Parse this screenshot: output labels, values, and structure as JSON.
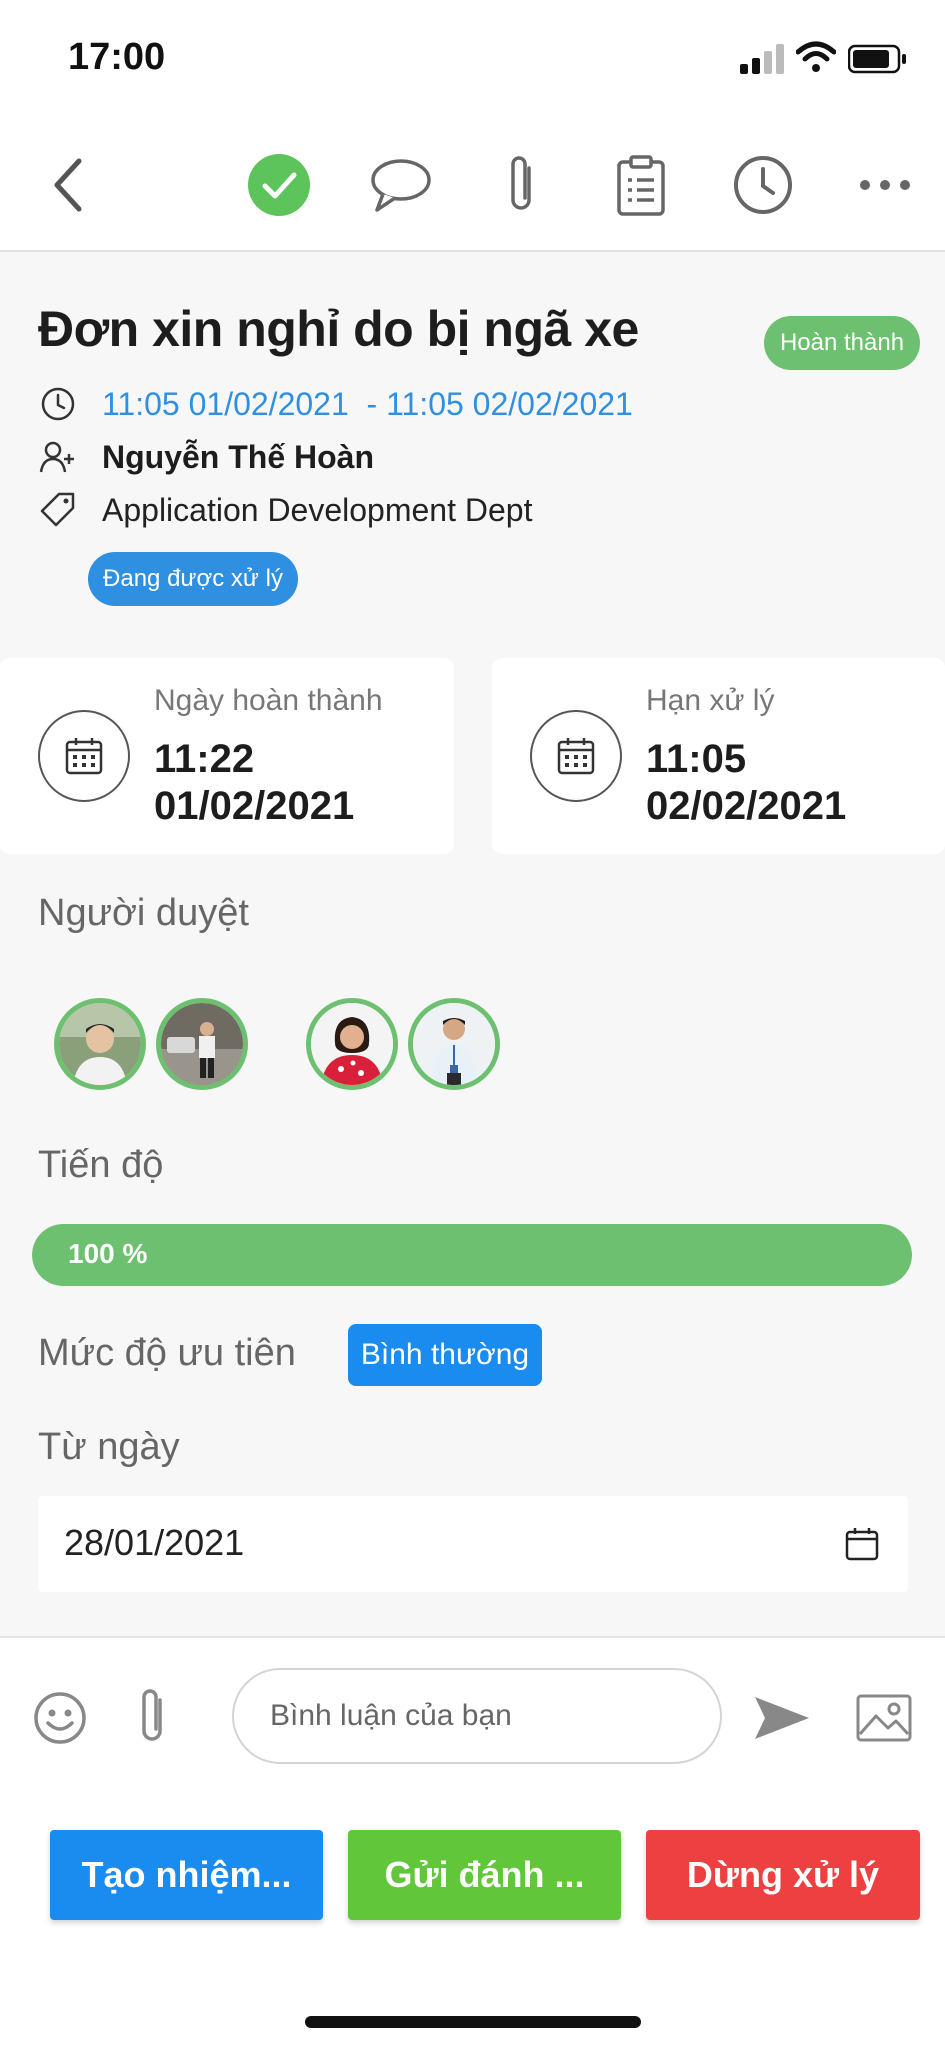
{
  "status_bar": {
    "time": "17:00"
  },
  "toolbar": {
    "icons": [
      "back-icon",
      "check-circle-icon",
      "chat-icon",
      "paperclip-icon",
      "clipboard-icon",
      "clock-icon",
      "more-icon"
    ],
    "accent": "#6cc070"
  },
  "task": {
    "title": "Đơn xin nghỉ do bị ngã xe",
    "status_badge": "Hoàn thành",
    "date_range": "11:05 01/02/2021  - 11:05 02/02/2021",
    "creator": "Nguyễn Thế Hoàn",
    "department": "Application Development Dept",
    "processing_badge": "Đang được xử lý"
  },
  "cards": [
    {
      "label": "Ngày hoàn thành",
      "time": "11:22",
      "date": "01/02/2021"
    },
    {
      "label": "Hạn xử lý",
      "time": "11:05",
      "date": "02/02/2021"
    }
  ],
  "approvers": {
    "label": "Người duyệt"
  },
  "progress": {
    "label": "Tiến độ",
    "value": 100,
    "text": "100 %"
  },
  "priority": {
    "label": "Mức độ ưu tiên",
    "value": "Bình thường"
  },
  "from_date": {
    "label": "Từ ngày",
    "value": "28/01/2021"
  },
  "comment": {
    "placeholder": "Bình luận của bạn"
  },
  "actions": {
    "create_task": "Tạo nhiệm...",
    "send_review": "Gửi đánh ...",
    "stop_processing": "Dừng xử lý"
  },
  "colors": {
    "blue": "#1a8cf0",
    "green": "#6cc070",
    "red": "#ee4040",
    "link": "#2f8fe0"
  }
}
